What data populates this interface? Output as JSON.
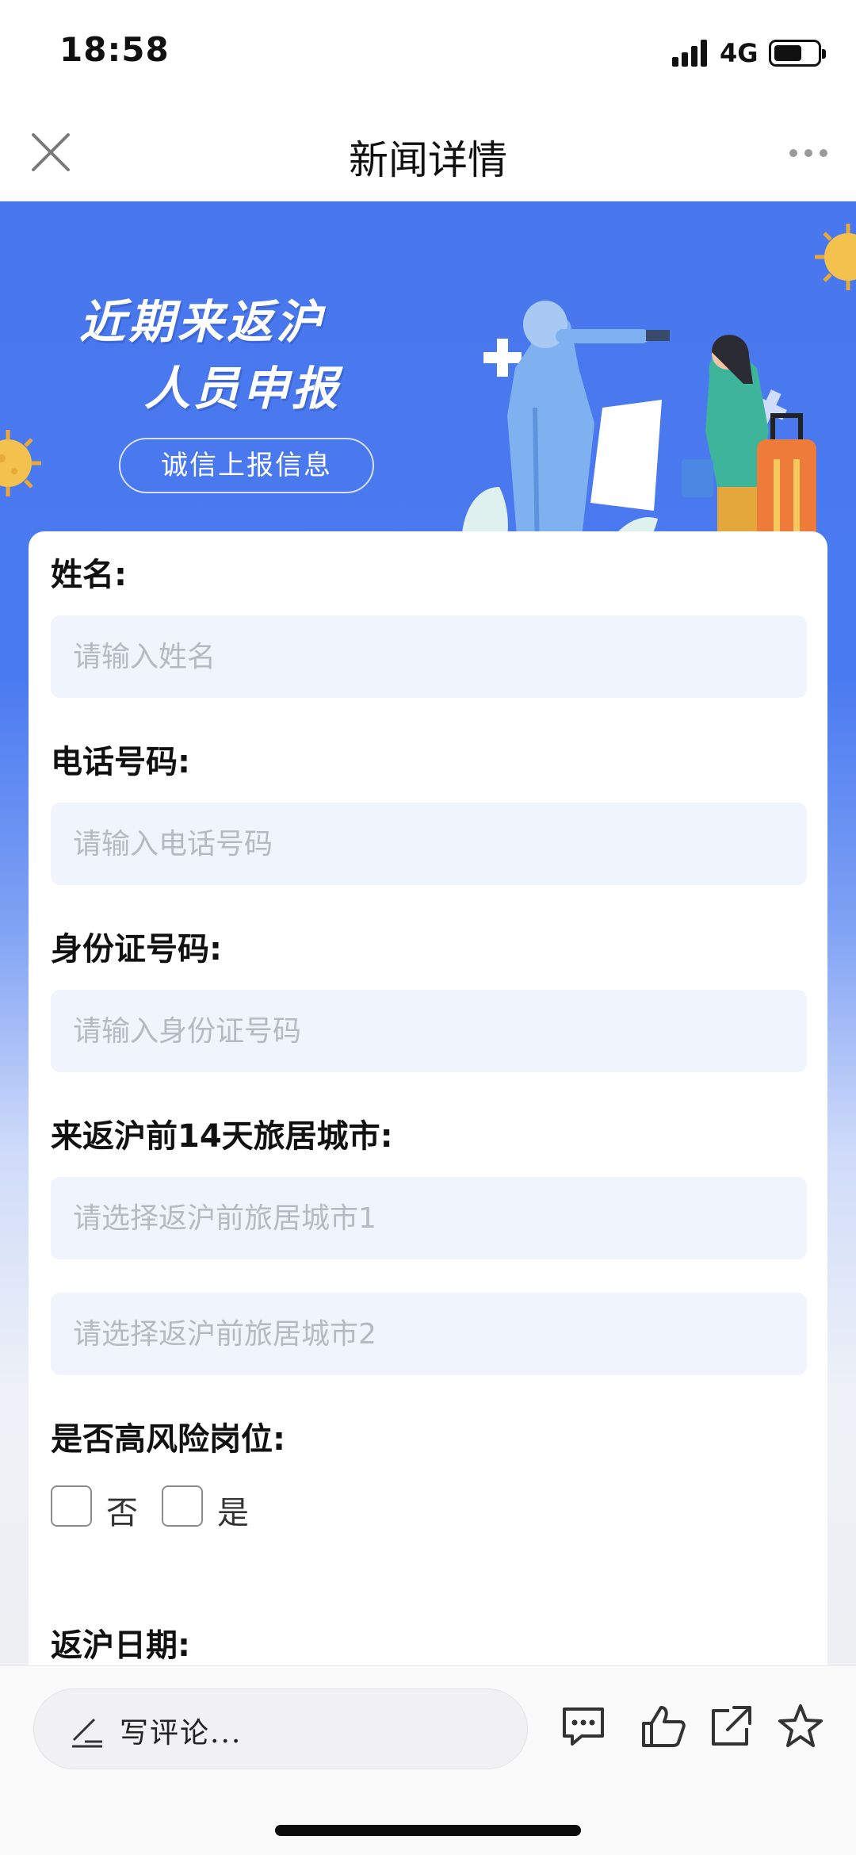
{
  "status_bar": {
    "time": "18:58",
    "network": "4G",
    "battery_level": 0.65
  },
  "nav": {
    "title": "新闻详情"
  },
  "banner": {
    "title_line1": "近期来返沪",
    "title_line2": "人员申报",
    "pill_label": "诚信上报信息"
  },
  "form": {
    "name": {
      "label": "姓名:",
      "placeholder": "请输入姓名"
    },
    "phone": {
      "label": "电话号码:",
      "placeholder": "请输入电话号码"
    },
    "id_number": {
      "label": "身份证号码:",
      "placeholder": "请输入身份证号码"
    },
    "cities": {
      "label": "来返沪前14天旅居城市:",
      "placeholder1": "请选择返沪前旅居城市1",
      "placeholder2": "请选择返沪前旅居城市2"
    },
    "high_risk": {
      "label": "是否高风险岗位:",
      "option_no": "否",
      "option_yes": "是"
    },
    "return_date": {
      "label": "返沪日期:"
    }
  },
  "bottom_bar": {
    "comment_placeholder": "写评论..."
  },
  "colors": {
    "banner_blue": "#4978ee",
    "input_bg": "#f0f4fd",
    "placeholder": "#b4bac4"
  },
  "icons": [
    "close-icon",
    "more-icon",
    "pen-icon",
    "comment-icon",
    "like-icon",
    "share-icon",
    "star-icon",
    "virus-icon"
  ]
}
